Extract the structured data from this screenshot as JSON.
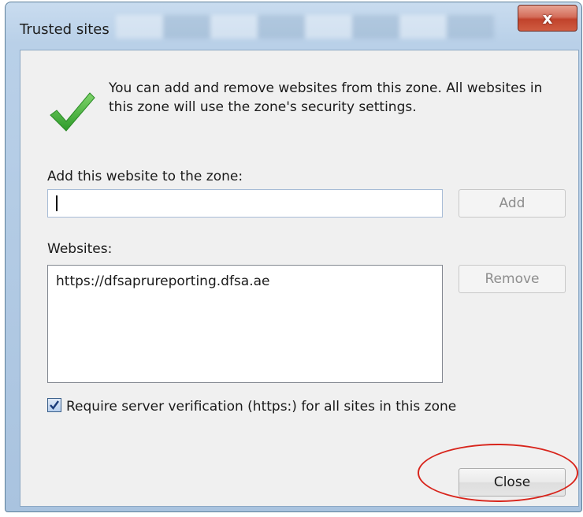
{
  "window": {
    "title": "Trusted sites",
    "close_glyph": "x"
  },
  "intro": {
    "icon": "checkmark-icon",
    "line1": "You can add and remove websites from this zone. All websites in",
    "line2": "this zone will use the zone's security settings."
  },
  "add": {
    "label": "Add this website to the zone:",
    "value": "",
    "button": "Add"
  },
  "websites": {
    "label": "Websites:",
    "items": [
      "https://dfsaprureporting.dfsa.ae"
    ],
    "remove_button": "Remove"
  },
  "require_https": {
    "checked": true,
    "label": "Require server verification (https:) for all sites in this zone"
  },
  "footer": {
    "close_button": "Close"
  },
  "colors": {
    "accent": "#d8251c",
    "check_green": "#3db035"
  }
}
